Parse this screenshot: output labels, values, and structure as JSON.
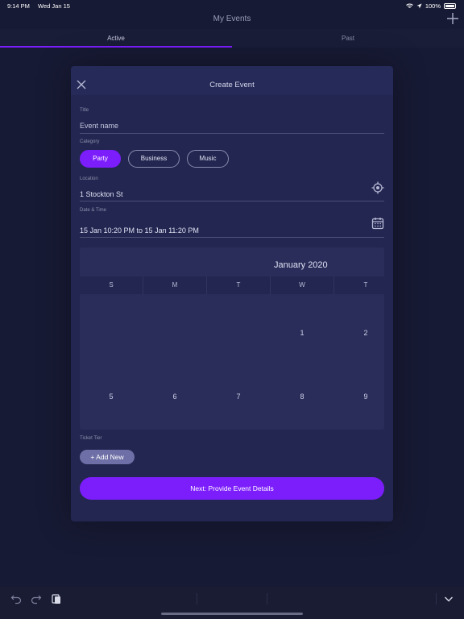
{
  "status_bar": {
    "time": "9:14 PM",
    "date": "Wed Jan 15",
    "battery": "100%"
  },
  "nav": {
    "title": "My Events"
  },
  "tabs": [
    {
      "label": "Active"
    },
    {
      "label": "Past"
    }
  ],
  "modal": {
    "title": "Create Event",
    "title_field": {
      "label": "Title",
      "placeholder": "Event name"
    },
    "category": {
      "label": "Category",
      "options": [
        "Party",
        "Business",
        "Music"
      ],
      "selected": "Party"
    },
    "location": {
      "label": "Location",
      "value": "1 Stockton St"
    },
    "datetime": {
      "label": "Date & Time",
      "value": "15 Jan 10:20 PM to 15 Jan 11:20 PM"
    },
    "calendar": {
      "month": "January 2020",
      "weekdays": [
        "S",
        "M",
        "T",
        "W",
        "T"
      ],
      "row1": [
        "",
        "",
        "",
        "1",
        "2"
      ],
      "row2": [
        "5",
        "6",
        "7",
        "8",
        "9"
      ]
    },
    "ticket_tier": {
      "label": "Ticket Tier",
      "add_label": "+ Add New"
    },
    "next_button": "Next: Provide Event Details"
  },
  "colors": {
    "accent": "#7c1dfc",
    "background": "#171a34",
    "card": "#232650"
  }
}
